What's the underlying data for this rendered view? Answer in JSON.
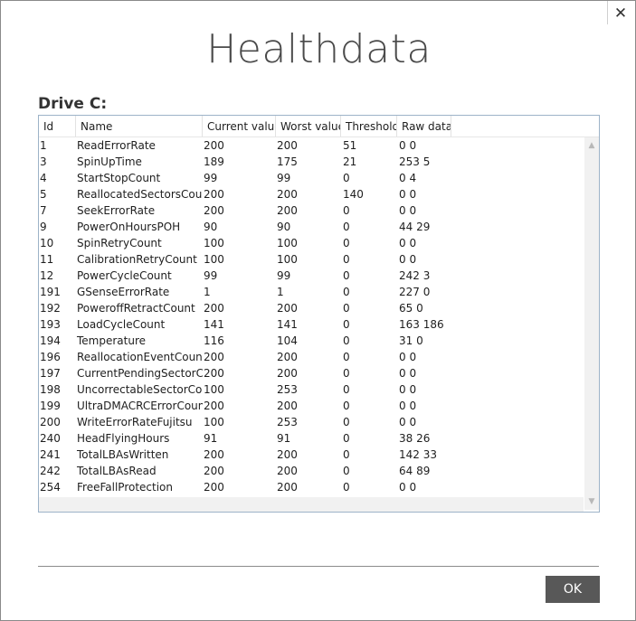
{
  "window": {
    "close_glyph": "✕",
    "close_icon": "close-icon"
  },
  "title": "Healthdata",
  "drive_label": "Drive C:",
  "table": {
    "columns": [
      "Id",
      "Name",
      "Current value",
      "Worst value",
      "Threshold",
      "Raw data"
    ],
    "rows": [
      [
        "1",
        "ReadErrorRate",
        "200",
        "200",
        "51",
        "0 0"
      ],
      [
        "3",
        "SpinUpTime",
        "189",
        "175",
        "21",
        "253 5"
      ],
      [
        "4",
        "StartStopCount",
        "99",
        "99",
        "0",
        "0 4"
      ],
      [
        "5",
        "ReallocatedSectorsCount",
        "200",
        "200",
        "140",
        "0 0"
      ],
      [
        "7",
        "SeekErrorRate",
        "200",
        "200",
        "0",
        "0 0"
      ],
      [
        "9",
        "PowerOnHoursPOH",
        "90",
        "90",
        "0",
        "44 29"
      ],
      [
        "10",
        "SpinRetryCount",
        "100",
        "100",
        "0",
        "0 0"
      ],
      [
        "11",
        "CalibrationRetryCount",
        "100",
        "100",
        "0",
        "0 0"
      ],
      [
        "12",
        "PowerCycleCount",
        "99",
        "99",
        "0",
        "242 3"
      ],
      [
        "191",
        "GSenseErrorRate",
        "1",
        "1",
        "0",
        "227 0"
      ],
      [
        "192",
        "PoweroffRetractCount",
        "200",
        "200",
        "0",
        "65 0"
      ],
      [
        "193",
        "LoadCycleCount",
        "141",
        "141",
        "0",
        "163 186"
      ],
      [
        "194",
        "Temperature",
        "116",
        "104",
        "0",
        "31 0"
      ],
      [
        "196",
        "ReallocationEventCount",
        "200",
        "200",
        "0",
        "0 0"
      ],
      [
        "197",
        "CurrentPendingSectorCou",
        "200",
        "200",
        "0",
        "0 0"
      ],
      [
        "198",
        "UncorrectableSectorCount",
        "100",
        "253",
        "0",
        "0 0"
      ],
      [
        "199",
        "UltraDMACRCErrorCount",
        "200",
        "200",
        "0",
        "0 0"
      ],
      [
        "200",
        "WriteErrorRateFujitsu",
        "100",
        "253",
        "0",
        "0 0"
      ],
      [
        "240",
        "HeadFlyingHours",
        "91",
        "91",
        "0",
        "38 26"
      ],
      [
        "241",
        "TotalLBAsWritten",
        "200",
        "200",
        "0",
        "142 33"
      ],
      [
        "242",
        "TotalLBAsRead",
        "200",
        "200",
        "0",
        "64 89"
      ],
      [
        "254",
        "FreeFallProtection",
        "200",
        "200",
        "0",
        "0 0"
      ]
    ]
  },
  "scroll": {
    "up_glyph": "▲",
    "down_glyph": "▼"
  },
  "ok_label": "OK"
}
